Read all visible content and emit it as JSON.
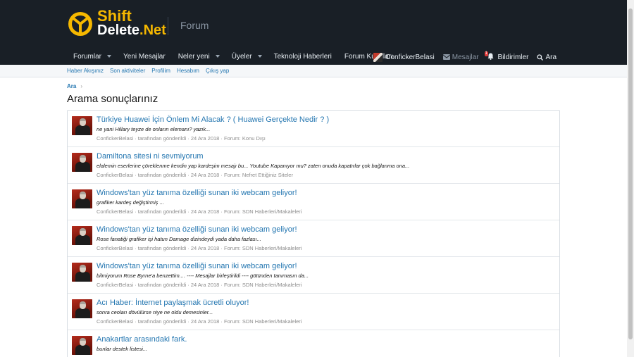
{
  "header": {
    "logo_line1": "Shift",
    "logo_line2_a": "Delete",
    "logo_line2_b": ".Net",
    "section_tag": "Forum"
  },
  "nav": {
    "items": [
      {
        "label": "Forumlar",
        "has_arrow": true
      },
      {
        "label": "Yeni Mesajlar",
        "has_arrow": false
      },
      {
        "label": "Neler yeni",
        "has_arrow": true
      },
      {
        "label": "Üyeler",
        "has_arrow": true
      },
      {
        "label": "Teknoloji Haberleri",
        "has_arrow": false
      },
      {
        "label": "Forum Kuralları",
        "has_arrow": false
      }
    ]
  },
  "user_nav": {
    "username": "ConfickerBelasi",
    "messages": "Mesajlar",
    "alerts": "Bildirimler",
    "alerts_count": "1",
    "search": "Ara"
  },
  "subnav": {
    "items": [
      "Haber Akışınız",
      "Son aktiviteler",
      "Profilim",
      "Hesabım",
      "Çıkış yap"
    ]
  },
  "breadcrumb": {
    "label": "Ara"
  },
  "page_title": "Arama sonuçlarınız",
  "results": [
    {
      "title": "Türkiye Huawei İçin Önlem Mi Alacak ? ( Huawei Gerçekte Nedir ? )",
      "snippet": "ne yani Hillary teyze de onların elemanı? yazık...",
      "author": "ConfickerBelasi",
      "posted_by": "tarafından gönderildi",
      "date": "24 Ara 2018",
      "forum": "Forum: Konu Dışı"
    },
    {
      "title": "Damiltona sitesi ni sevmiyorum",
      "snippet": "elalemin eserlerine çöreklenme kendin yap kardeşim mesajı bu... Youtube Kapanıyor mu? zaten onuda kapatırlar çok bağlanma ona...",
      "author": "ConfickerBelasi",
      "posted_by": "tarafından gönderildi",
      "date": "24 Ara 2018",
      "forum": "Forum: Nefret Ettiğiniz Siteler"
    },
    {
      "title": "Windows'tan yüz tanıma özelliği sunan iki webcam geliyor!",
      "snippet": "grafiker kardeş değiştirmiş ...",
      "author": "ConfickerBelasi",
      "posted_by": "tarafından gönderildi",
      "date": "24 Ara 2018",
      "forum": "Forum: SDN Haberleri/Makaleleri"
    },
    {
      "title": "Windows'tan yüz tanıma özelliği sunan iki webcam geliyor!",
      "snippet": "Rose fanatiği grafiker işi hatun Damage dizindeydi yada daha fazlası...",
      "author": "ConfickerBelasi",
      "posted_by": "tarafından gönderildi",
      "date": "24 Ara 2018",
      "forum": "Forum: SDN Haberleri/Makaleleri"
    },
    {
      "title": "Windows'tan yüz tanıma özelliği sunan iki webcam geliyor!",
      "snippet": "bilmiyorum Rose Byrne'a benzettim.... ---- Mesajlar birleştirildi ---- götünden tanımasın da...",
      "author": "ConfickerBelasi",
      "posted_by": "tarafından gönderildi",
      "date": "24 Ara 2018",
      "forum": "Forum: SDN Haberleri/Makaleleri"
    },
    {
      "title": "Acı Haber: İnternet paylaşmak ücretli oluyor!",
      "snippet": "sonra ceoları dövülürse niye ne oldu demesinler...",
      "author": "ConfickerBelasi",
      "posted_by": "tarafından gönderildi",
      "date": "24 Ara 2018",
      "forum": "Forum: SDN Haberleri/Makaleleri"
    },
    {
      "title": "Anakartlar arasındaki fark.",
      "snippet": "bunlar destek listesi...",
      "author": "",
      "posted_by": "",
      "date": "",
      "forum": ""
    }
  ]
}
